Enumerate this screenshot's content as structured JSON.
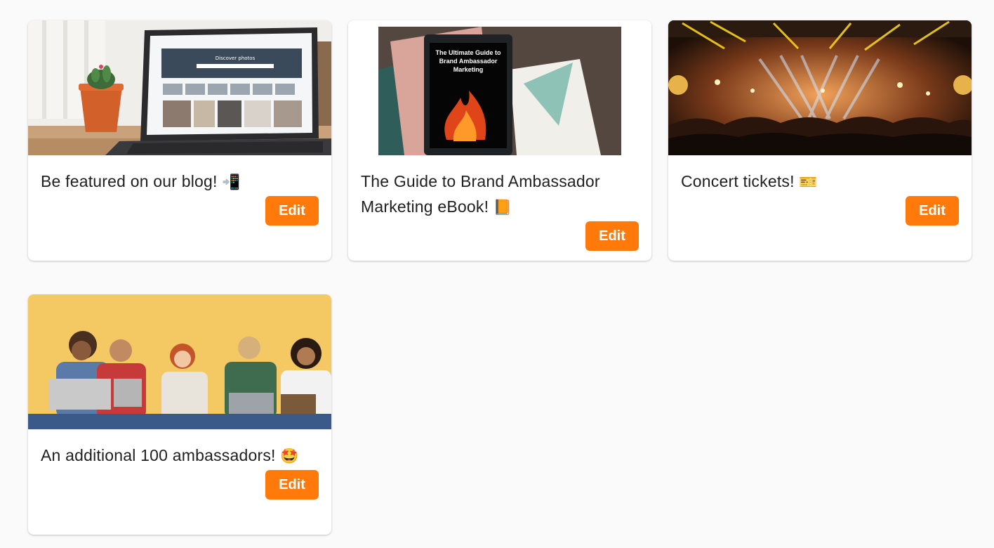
{
  "accent_color": "#ff7a0a",
  "rewards": [
    {
      "title": "Be featured on our blog!",
      "emoji": "📲",
      "emoji_name": "mobile-phone-icon",
      "image": "laptop-on-desk-photo",
      "edit_label": "Edit"
    },
    {
      "title": "The Guide to Brand Ambassador Marketing eBook!",
      "emoji": "📙",
      "emoji_name": "orange-book-icon",
      "image": "ebook-cover-photo",
      "image_text": "The Ultimate Guide to Brand Ambassador Marketing",
      "edit_label": "Edit"
    },
    {
      "title": "Concert tickets!",
      "emoji": "🎫",
      "emoji_name": "ticket-icon",
      "image": "concert-crowd-photo",
      "edit_label": "Edit"
    },
    {
      "title": "An additional 100 ambassadors!",
      "emoji": "🤩",
      "emoji_name": "star-struck-icon",
      "image": "group-of-friends-photo",
      "edit_label": "Edit"
    }
  ]
}
